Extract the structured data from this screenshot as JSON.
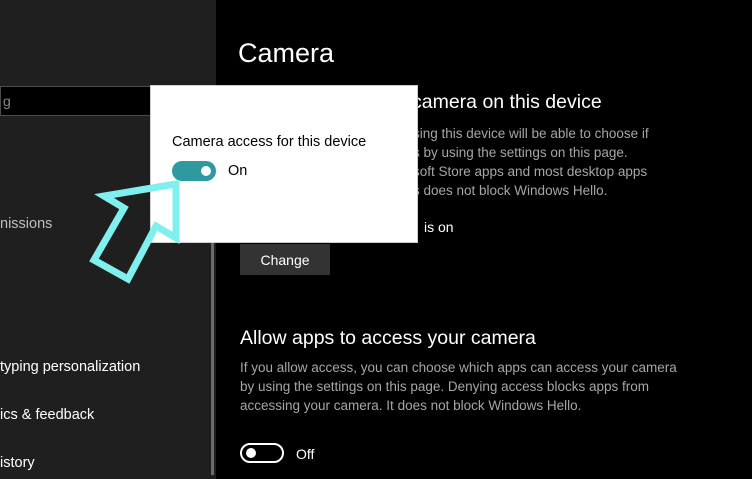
{
  "sidebar": {
    "search_text": "g",
    "items": [
      {
        "label": "nissions"
      },
      {
        "label": "typing personalization"
      },
      {
        "label": "ics & feedback"
      },
      {
        "label": "istory"
      }
    ]
  },
  "main": {
    "title": "Camera",
    "section1": {
      "heading": "camera on this device",
      "desc_lines": [
        "sing this device will be able to choose if",
        "s by using the settings on this page.",
        "soft Store apps and most desktop apps",
        "s does not block Windows Hello."
      ],
      "status": "is on",
      "change_label": "Change"
    },
    "section2": {
      "heading": "Allow apps to access your camera",
      "desc_lines": [
        "If you allow access, you can choose which apps can access your camera",
        "by using the settings on this page. Denying access blocks apps from",
        "accessing your camera. It does not block Windows Hello."
      ],
      "toggle_label": "Off",
      "toggle_on": false
    }
  },
  "popup": {
    "title": "Camera access for this device",
    "toggle_label": "On",
    "toggle_on": true,
    "accent": "#2e9aa0"
  },
  "annotation": {
    "arrow_color": "#7ff0ee",
    "icon": "pointer-arrow-icon"
  }
}
